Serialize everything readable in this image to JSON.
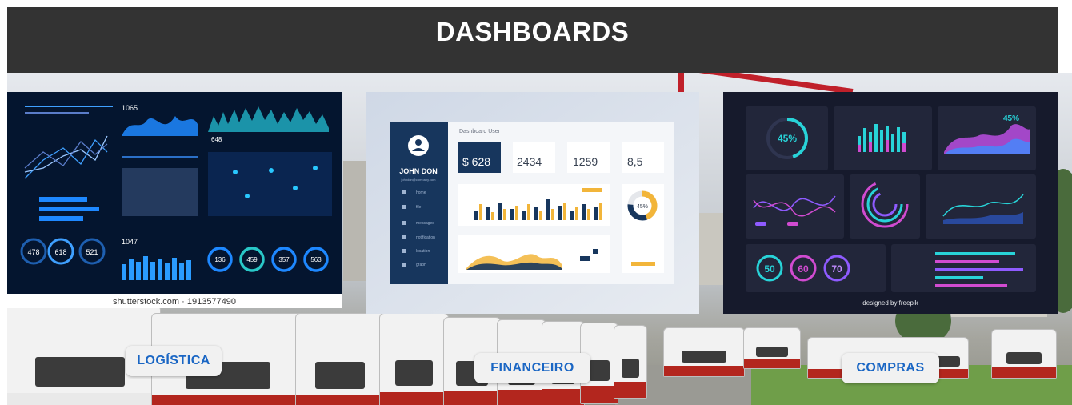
{
  "header": {
    "title": "DASHBOARDS"
  },
  "cards": {
    "logistica": {
      "watermark": "shutterstock.com · 1913577490",
      "stat_1": "1065",
      "stat_2": "648",
      "stat_3": "1047",
      "rings": [
        "478",
        "618",
        "521"
      ],
      "gauges": [
        "136",
        "459",
        "357",
        "563"
      ]
    },
    "financeiro": {
      "title": "Dashboard User",
      "user_name": "JOHN DON",
      "user_email": "johndon@company.com",
      "menu": [
        "home",
        "file",
        "messages",
        "notification",
        "location",
        "graph"
      ],
      "kpis": [
        "$ 628",
        "2434",
        "1259",
        "8,5"
      ],
      "donut": "45%"
    },
    "compras": {
      "ring_value": "45%",
      "area_value": "45%",
      "circles": [
        "50",
        "60",
        "70"
      ],
      "credit": "designed by freepik"
    }
  },
  "buttons": {
    "logistica": "LOGÍSTICA",
    "financeiro": "FINANCEIRO",
    "compras": "COMPRAS"
  },
  "colors": {
    "header_bg": "#333333",
    "button_text": "#1a66c4",
    "button_bg": "#f1f1f1"
  }
}
